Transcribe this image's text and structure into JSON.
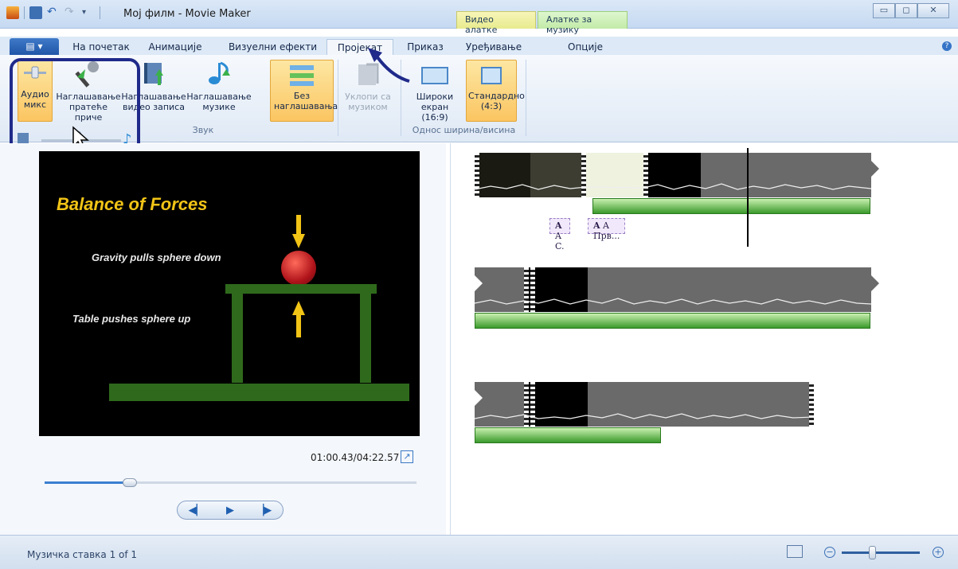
{
  "window": {
    "title": "Мој филм - Movie Maker",
    "context_tabs": {
      "video_tools": "Видео алатке",
      "music_tools": "Алатке за музику"
    }
  },
  "tabs": {
    "file_menu": "▤ ▾",
    "items": [
      "На почетак",
      "Анимације",
      "Визуелни ефекти",
      "Пројекат",
      "Приказ",
      "Уређивање",
      "Опције"
    ],
    "active": "Пројекат"
  },
  "ribbon": {
    "buttons": {
      "audio_mix": "Аудио микс",
      "emphasize_narration": "Наглашавање пратеће приче",
      "emphasize_video": "Наглашавање видео записа",
      "emphasize_music": "Наглашавање музике",
      "no_emphasis": "Без наглашавања",
      "fit_to_music": "Уклопи са музиком",
      "widescreen": "Широки екран (16:9)",
      "standard": "Стандардно (4:3)"
    },
    "groups": {
      "sound": "Звук",
      "aspect_ratio": "Однос ширина/висина"
    },
    "audio_mix_slider": 0.45
  },
  "preview": {
    "slide_title": "Balance of Forces",
    "slide_text_1": "Gravity pulls sphere down",
    "slide_text_2": "Table pushes sphere up",
    "timecode": "01:00.43/04:22.57",
    "seek_progress": 0.23
  },
  "storyboard": {
    "captions": [
      "A C.",
      "A Прв..."
    ]
  },
  "status": {
    "text": "Музичка ставка 1 of 1"
  },
  "colors": {
    "accent": "#1f2a8a",
    "selected": "#fbc561",
    "music_clip": "#3a9a2b",
    "caption_bg": "#f1e9fb"
  }
}
